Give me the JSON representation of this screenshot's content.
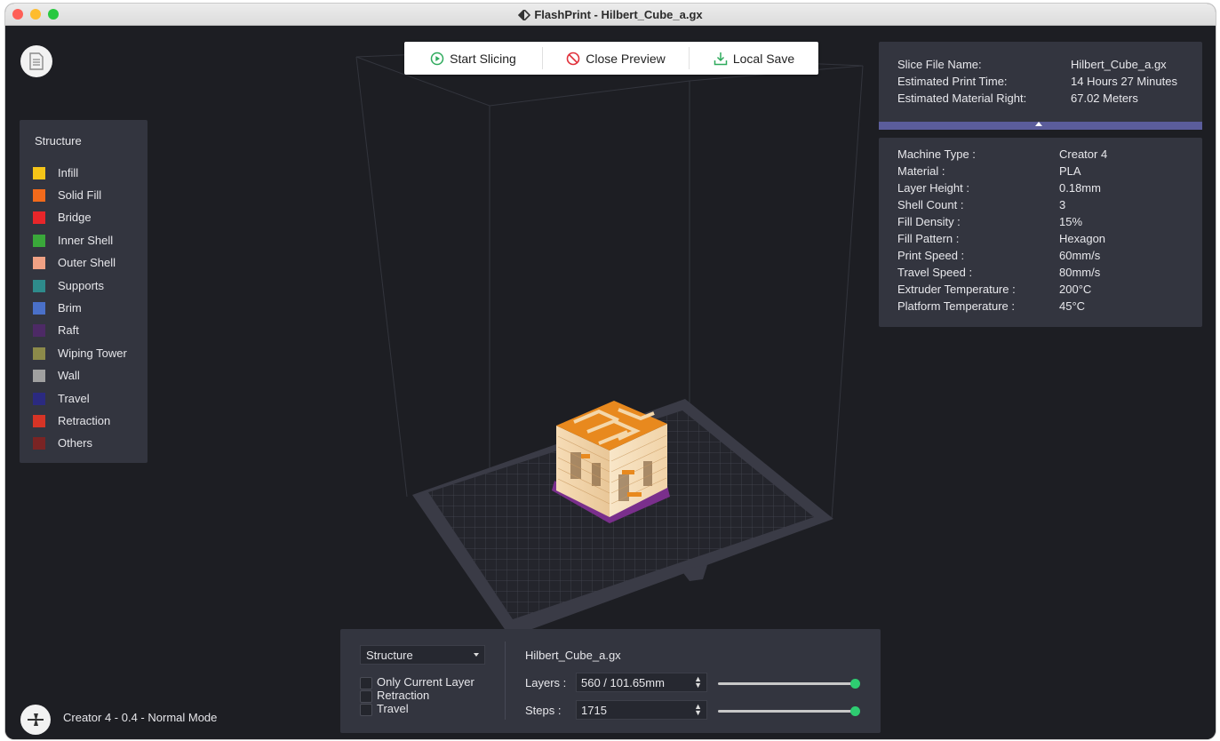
{
  "window": {
    "title": "FlashPrint - Hilbert_Cube_a.gx"
  },
  "traffic_lights": {
    "close": "#fe5f57",
    "minimize": "#febc2e",
    "maximize": "#28c840"
  },
  "toolbar": {
    "start_slicing": "Start Slicing",
    "close_preview": "Close Preview",
    "local_save": "Local Save"
  },
  "legend": {
    "title": "Structure",
    "items": [
      {
        "label": "Infill",
        "color": "#f5c518"
      },
      {
        "label": "Solid Fill",
        "color": "#f26a1b"
      },
      {
        "label": "Bridge",
        "color": "#e8262a"
      },
      {
        "label": "Inner Shell",
        "color": "#3aa83a"
      },
      {
        "label": "Outer Shell",
        "color": "#f0a184"
      },
      {
        "label": "Supports",
        "color": "#2e8b8b"
      },
      {
        "label": "Brim",
        "color": "#4a70c8"
      },
      {
        "label": "Raft",
        "color": "#4d2a66"
      },
      {
        "label": "Wiping Tower",
        "color": "#8c8a4a"
      },
      {
        "label": "Wall",
        "color": "#a0a0a0"
      },
      {
        "label": "Travel",
        "color": "#2b2a80"
      },
      {
        "label": "Retraction",
        "color": "#d63426"
      },
      {
        "label": "Others",
        "color": "#7a2424"
      }
    ]
  },
  "slice_info": [
    {
      "key": "Slice File Name:",
      "value": "Hilbert_Cube_a.gx"
    },
    {
      "key": "Estimated Print Time:",
      "value": "14 Hours 27 Minutes"
    },
    {
      "key": "Estimated Material Right:",
      "value": "67.02 Meters"
    }
  ],
  "machine_info": [
    {
      "key": "Machine Type :",
      "value": "Creator 4"
    },
    {
      "key": "Material :",
      "value": "PLA"
    },
    {
      "key": "Layer Height :",
      "value": "0.18mm"
    },
    {
      "key": "Shell Count :",
      "value": "3"
    },
    {
      "key": "Fill Density :",
      "value": "15%"
    },
    {
      "key": "Fill Pattern :",
      "value": "Hexagon"
    },
    {
      "key": "Print Speed :",
      "value": "60mm/s"
    },
    {
      "key": "Travel Speed :",
      "value": "80mm/s"
    },
    {
      "key": "Extruder Temperature :",
      "value": "200°C"
    },
    {
      "key": "Platform Temperature :",
      "value": "45°C"
    }
  ],
  "bottom_panel": {
    "view_select": "Structure",
    "checkboxes": [
      {
        "label": "Only Current Layer",
        "checked": false
      },
      {
        "label": "Retraction",
        "checked": false
      },
      {
        "label": "Travel",
        "checked": false
      }
    ],
    "file_name": "Hilbert_Cube_a.gx",
    "layers_label": "Layers :",
    "layers_value": "560 / 101.65mm",
    "layers_position": 1.0,
    "steps_label": "Steps :",
    "steps_value": "1715",
    "steps_position": 1.0,
    "accent": "#2ecc71"
  },
  "status": {
    "text": "Creator 4 - 0.4 - Normal Mode"
  }
}
